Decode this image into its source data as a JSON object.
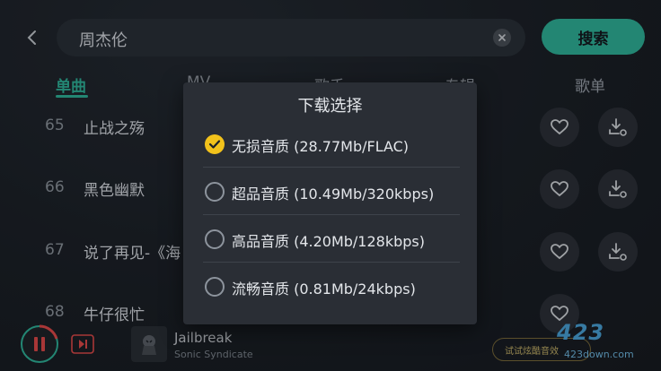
{
  "search": {
    "query": "周杰伦",
    "button_label": "搜索"
  },
  "tabs": [
    {
      "label": "单曲"
    },
    {
      "label": "MV"
    },
    {
      "label": "歌手"
    },
    {
      "label": "专辑"
    },
    {
      "label": "歌单"
    }
  ],
  "songs": [
    {
      "num": "65",
      "title": "止战之殇"
    },
    {
      "num": "66",
      "title": "黑色幽默"
    },
    {
      "num": "67",
      "title": "说了再见-《海"
    },
    {
      "num": "68",
      "title": "牛仔很忙"
    }
  ],
  "player": {
    "track_title": "Jailbreak",
    "track_artist": "Sonic Syndicate",
    "ad_text": "试试炫酷音效"
  },
  "watermark": {
    "logo": "423",
    "domain": "423down.com"
  },
  "dialog": {
    "title": "下载选择",
    "options": [
      {
        "label": "无损音质  (28.77Mb/FLAC)",
        "selected": true
      },
      {
        "label": "超品音质  (10.49Mb/320kbps)",
        "selected": false
      },
      {
        "label": "高品音质  (4.20Mb/128kbps)",
        "selected": false
      },
      {
        "label": "流畅音质  (0.81Mb/24kbps)",
        "selected": false
      }
    ]
  },
  "colors": {
    "accent": "#2fb39a",
    "selected": "#f2c21b",
    "background": "#1b2027"
  }
}
